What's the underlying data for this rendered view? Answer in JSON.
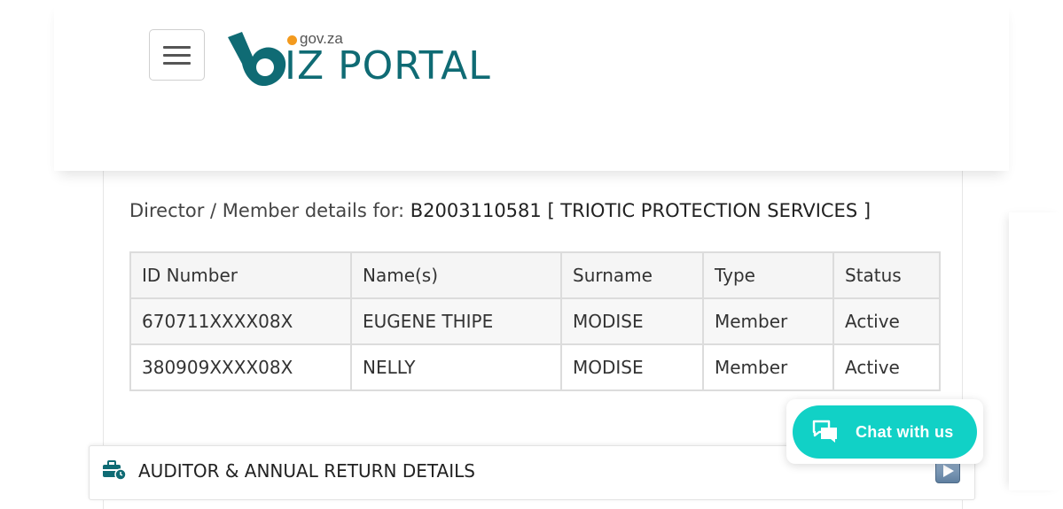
{
  "header": {
    "menu_icon": "hamburger-icon",
    "logo": {
      "domain": "gov.za",
      "word": "IZ PORTAL"
    }
  },
  "details": {
    "label": "Director / Member details for:",
    "company": "B2003110581 [ TRIOTIC PROTECTION SERVICES ]"
  },
  "table": {
    "headers": [
      "ID Number",
      "Name(s)",
      "Surname",
      "Type",
      "Status"
    ],
    "rows": [
      [
        "670711XXXX08X",
        "EUGENE THIPE",
        "MODISE",
        "Member",
        "Active"
      ],
      [
        "380909XXXX08X",
        "NELLY",
        "MODISE",
        "Member",
        "Active"
      ]
    ]
  },
  "auditor": {
    "label": "AUDITOR & ANNUAL RETURN DETAILS",
    "icon": "briefcase-clock-icon",
    "expand_icon": "play-icon"
  },
  "chat": {
    "label": "Chat with us",
    "icon": "chat-bubbles-icon",
    "color": "#11d1c6"
  },
  "colors": {
    "brand_teal": "#0f6b74",
    "brand_orange": "#f39a1e"
  }
}
